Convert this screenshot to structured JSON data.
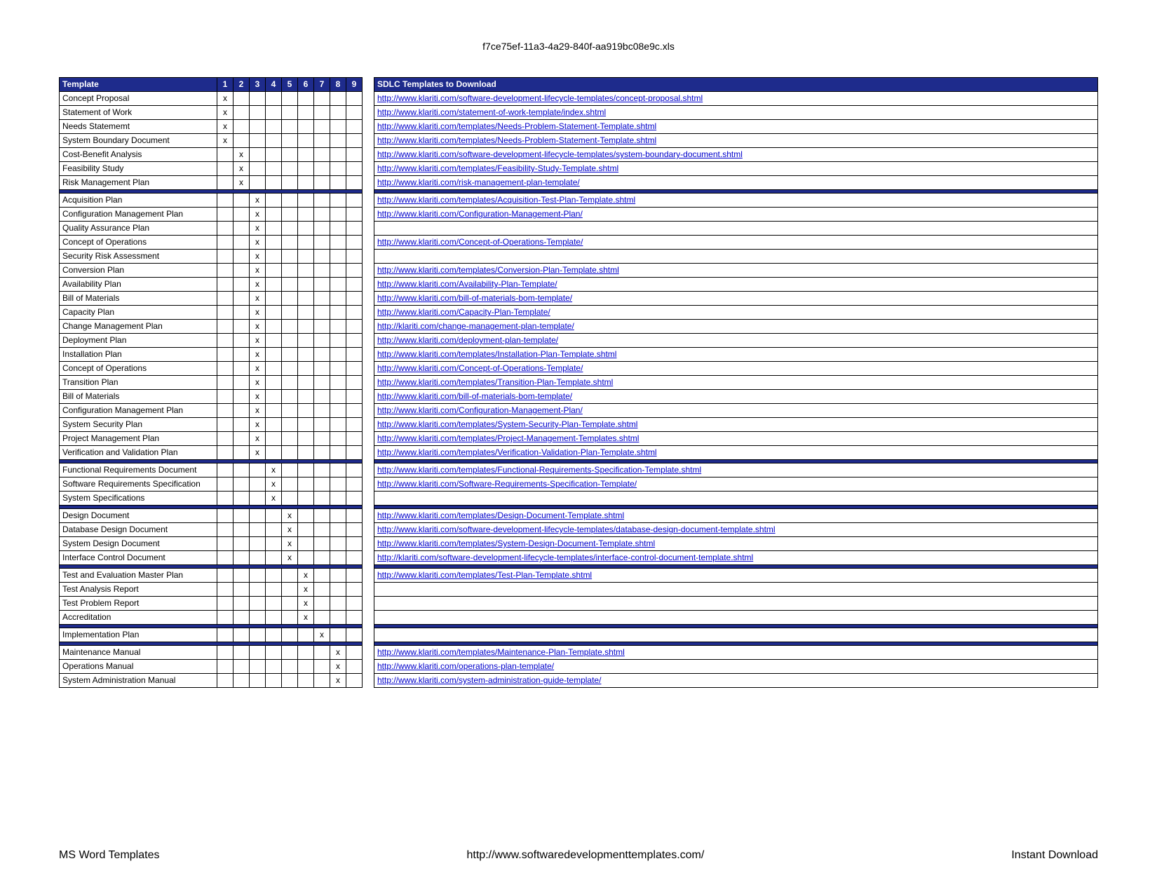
{
  "title": "f7ce75ef-11a3-4a29-840f-aa919bc08e9c.xls",
  "header": {
    "template_col": "Template",
    "num_cols": [
      "1",
      "2",
      "3",
      "4",
      "5",
      "6",
      "7",
      "8",
      "9"
    ],
    "link_col": "SDLC Templates to Download"
  },
  "groups": [
    {
      "rows": [
        {
          "template": "Concept Proposal",
          "phase": 1,
          "url": "http://www.klariti.com/software-development-lifecycle-templates/concept-proposal.shtml"
        },
        {
          "template": "Statement of Work",
          "phase": 1,
          "url": "http://www.klariti.com/statement-of-work-template/index.shtml"
        },
        {
          "template": "Needs Statememt",
          "phase": 1,
          "url": "http://www.klariti.com/templates/Needs-Problem-Statement-Template.shtml"
        },
        {
          "template": "System Boundary Document",
          "phase": 1,
          "url": "http://www.klariti.com/templates/Needs-Problem-Statement-Template.shtml"
        },
        {
          "template": "Cost-Benefit Analysis",
          "phase": 2,
          "url": "http://www.klariti.com/software-development-lifecycle-templates/system-boundary-document.shtml"
        },
        {
          "template": "Feasibility Study",
          "phase": 2,
          "url": "http://www.klariti.com/templates/Feasibility-Study-Template.shtml"
        },
        {
          "template": "Risk Management Plan",
          "phase": 2,
          "url": "http://www.klariti.com/risk-management-plan-template/"
        }
      ]
    },
    {
      "rows": [
        {
          "template": "Acquisition Plan",
          "phase": 3,
          "url": "http://www.klariti.com/templates/Acquisition-Test-Plan-Template.shtml"
        },
        {
          "template": "Configuration Management Plan",
          "phase": 3,
          "url": "http://www.klariti.com/Configuration-Management-Plan/"
        },
        {
          "template": "Quality Assurance Plan",
          "phase": 3,
          "url": ""
        },
        {
          "template": "Concept of Operations",
          "phase": 3,
          "url": "http://www.klariti.com/Concept-of-Operations-Template/"
        },
        {
          "template": "Security Risk Assessment",
          "phase": 3,
          "url": ""
        },
        {
          "template": "Conversion Plan",
          "phase": 3,
          "url": "http://www.klariti.com/templates/Conversion-Plan-Template.shtml"
        },
        {
          "template": "Availability Plan",
          "phase": 3,
          "url": "http://www.klariti.com/Availability-Plan-Template/"
        },
        {
          "template": "Bill of Materials",
          "phase": 3,
          "url": "http://www.klariti.com/bill-of-materials-bom-template/"
        },
        {
          "template": "Capacity Plan",
          "phase": 3,
          "url": "http://www.klariti.com/Capacity-Plan-Template/"
        },
        {
          "template": "Change Management Plan",
          "phase": 3,
          "url": "http://klariti.com/change-management-plan-template/"
        },
        {
          "template": "Deployment Plan",
          "phase": 3,
          "url": "http://www.klariti.com/deployment-plan-template/"
        },
        {
          "template": "Installation Plan",
          "phase": 3,
          "url": "http://www.klariti.com/templates/Installation-Plan-Template.shtml"
        },
        {
          "template": "Concept of Operations",
          "phase": 3,
          "url": "http://www.klariti.com/Concept-of-Operations-Template/"
        },
        {
          "template": "Transition Plan",
          "phase": 3,
          "url": "http://www.klariti.com/templates/Transition-Plan-Template.shtml"
        },
        {
          "template": "Bill of Materials",
          "phase": 3,
          "url": "http://www.klariti.com/bill-of-materials-bom-template/"
        },
        {
          "template": "Configuration Management Plan",
          "phase": 3,
          "url": "http://www.klariti.com/Configuration-Management-Plan/"
        },
        {
          "template": "System Security Plan",
          "phase": 3,
          "url": "http://www.klariti.com/templates/System-Security-Plan-Template.shtml"
        },
        {
          "template": "Project Management Plan",
          "phase": 3,
          "url": "http://www.klariti.com/templates/Project-Management-Templates.shtml"
        },
        {
          "template": "Verification and Validation Plan",
          "phase": 3,
          "url": "http://www.klariti.com/templates/Verification-Validation-Plan-Template.shtml"
        }
      ]
    },
    {
      "rows": [
        {
          "template": "Functional Requirements Document",
          "phase": 4,
          "url": "http://www.klariti.com/templates/Functional-Requirements-Specification-Template.shtml"
        },
        {
          "template": "Software Requirements Specification",
          "phase": 4,
          "url": "http://www.klariti.com/Software-Requirements-Specification-Template/"
        },
        {
          "template": "System Specifications",
          "phase": 4,
          "url": ""
        }
      ]
    },
    {
      "rows": [
        {
          "template": "Design Document",
          "phase": 5,
          "url": "http://www.klariti.com/templates/Design-Document-Template.shtml"
        },
        {
          "template": "Database Design Document",
          "phase": 5,
          "url": "http://www.klariti.com/software-development-lifecycle-templates/database-design-document-template.shtml"
        },
        {
          "template": "System Design Document",
          "phase": 5,
          "url": "http://www.klariti.com/templates/System-Design-Document-Template.shtml"
        },
        {
          "template": "Interface Control Document",
          "phase": 5,
          "url": "http://klariti.com/software-development-lifecycle-templates/interface-control-document-template.shtml"
        }
      ]
    },
    {
      "rows": [
        {
          "template": "Test and Evaluation Master Plan",
          "phase": 6,
          "url": "http://www.klariti.com/templates/Test-Plan-Template.shtml"
        },
        {
          "template": "Test Analysis Report",
          "phase": 6,
          "url": ""
        },
        {
          "template": "Test Problem Report",
          "phase": 6,
          "url": ""
        },
        {
          "template": "Accreditation",
          "phase": 6,
          "url": ""
        }
      ]
    },
    {
      "rows": [
        {
          "template": "Implementation Plan",
          "phase": 7,
          "url": ""
        }
      ]
    },
    {
      "rows": [
        {
          "template": "Maintenance Manual",
          "phase": 8,
          "url": "http://www.klariti.com/templates/Maintenance-Plan-Template.shtml"
        },
        {
          "template": "Operations Manual",
          "phase": 8,
          "url": "http://www.klariti.com/operations-plan-template/"
        },
        {
          "template": "System Administration Manual",
          "phase": 8,
          "url": "http://www.klariti.com/system-administration-guide-template/"
        }
      ]
    }
  ],
  "footer": {
    "left": "MS Word Templates",
    "center": "http://www.softwaredevelopmenttemplates.com/",
    "right": "Instant Download"
  }
}
